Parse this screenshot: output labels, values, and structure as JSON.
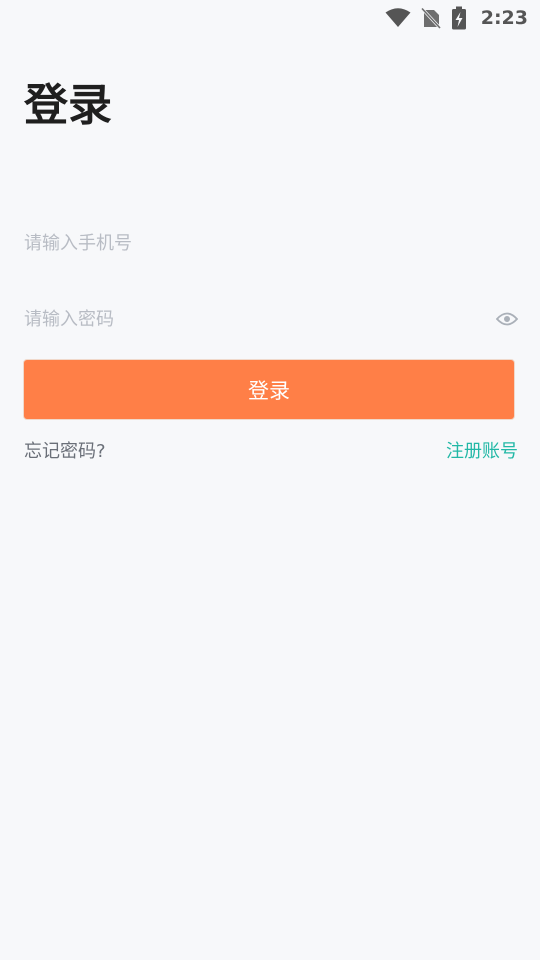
{
  "status_bar": {
    "time": "2:23",
    "icons": [
      "wifi-icon",
      "no-sim-icon",
      "battery-charging-icon"
    ]
  },
  "page": {
    "title": "登录"
  },
  "form": {
    "phone_placeholder": "请输入手机号",
    "phone_value": "",
    "password_placeholder": "请输入密码",
    "password_value": "",
    "password_toggle_icon": "eye-icon",
    "login_button_label": "登录"
  },
  "links": {
    "forgot_password": "忘记密码?",
    "register": "注册账号"
  },
  "colors": {
    "background": "#f7f8fa",
    "primary_button": "#ff7f47",
    "register_link": "#22b8a6",
    "title_text": "#1f1f1f",
    "placeholder_text": "#b8bcc4"
  }
}
